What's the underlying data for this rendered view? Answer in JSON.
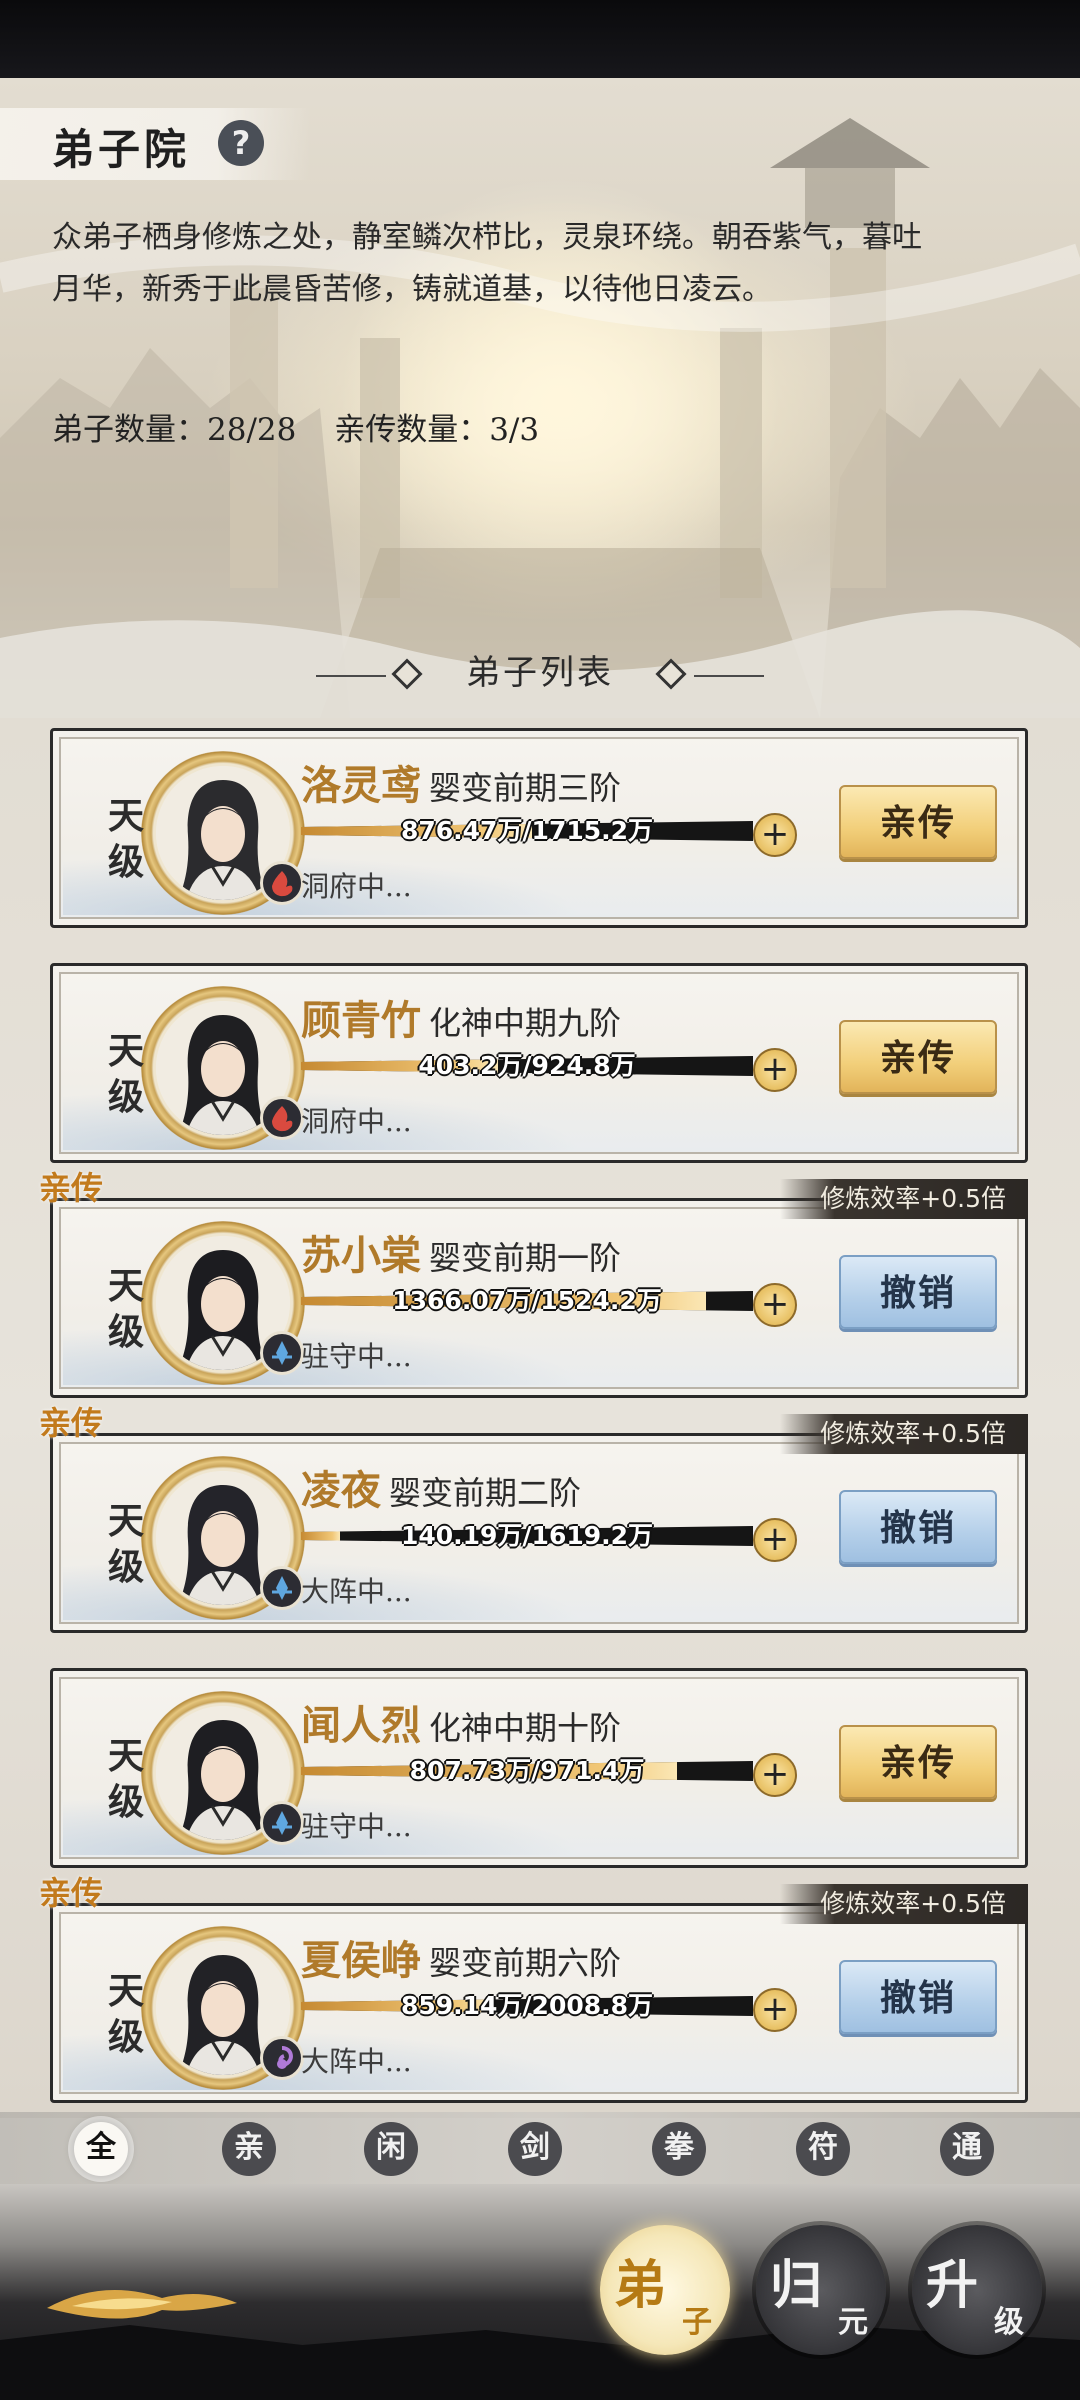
{
  "header": {
    "title": "弟子院",
    "help_icon": "question-icon",
    "help_label": "?",
    "description": "众弟子栖身修炼之处，静室鳞次栉比，灵泉环绕。朝吞紫气，暮吐月华，新秀于此晨昏苦修，铸就道基，以待他日凌云。",
    "disciple_count": "弟子数量：28/28",
    "direct_count": "亲传数量：3/3"
  },
  "list_title": "弟子列表",
  "disciples": [
    {
      "grade_top": "天",
      "grade_bottom": "级",
      "name": "洛灵鸢",
      "realm": "婴变前期三阶",
      "progress_text": "876.47万/1715.2万",
      "progress": 0.511,
      "status": "洞府中...",
      "action": "亲传",
      "action_style": "gold",
      "is_direct": false,
      "bonus": "",
      "element_icon": "fire-icon",
      "element_color": "#d94a3f"
    },
    {
      "grade_top": "天",
      "grade_bottom": "级",
      "name": "顾青竹",
      "realm": "化神中期九阶",
      "progress_text": "403.2万/924.8万",
      "progress": 0.436,
      "status": "洞府中...",
      "action": "亲传",
      "action_style": "gold",
      "is_direct": false,
      "bonus": "",
      "element_icon": "fire-icon",
      "element_color": "#d94a3f"
    },
    {
      "grade_top": "天",
      "grade_bottom": "级",
      "name": "苏小棠",
      "realm": "婴变前期一阶",
      "progress_text": "1366.07万/1524.2万",
      "progress": 0.896,
      "status": "驻守中...",
      "action": "撤销",
      "action_style": "blue",
      "is_direct": true,
      "direct_tag": "亲传",
      "bonus": "修炼效率+0.5倍",
      "element_icon": "water-icon",
      "element_color": "#5fa7e0"
    },
    {
      "grade_top": "天",
      "grade_bottom": "级",
      "name": "凌夜",
      "realm": "婴变前期二阶",
      "progress_text": "140.19万/1619.2万",
      "progress": 0.087,
      "status": "大阵中...",
      "action": "撤销",
      "action_style": "blue",
      "is_direct": true,
      "direct_tag": "亲传",
      "bonus": "修炼效率+0.5倍",
      "element_icon": "water-icon",
      "element_color": "#5fa7e0"
    },
    {
      "grade_top": "天",
      "grade_bottom": "级",
      "name": "闻人烈",
      "realm": "化神中期十阶",
      "progress_text": "807.73万/971.4万",
      "progress": 0.831,
      "status": "驻守中...",
      "action": "亲传",
      "action_style": "gold",
      "is_direct": false,
      "bonus": "",
      "element_icon": "water-icon",
      "element_color": "#5fa7e0"
    },
    {
      "grade_top": "天",
      "grade_bottom": "级",
      "name": "夏侯峥",
      "realm": "婴变前期六阶",
      "progress_text": "859.14万/2008.8万",
      "progress": 0.428,
      "status": "大阵中...",
      "action": "撤销",
      "action_style": "blue",
      "is_direct": true,
      "direct_tag": "亲传",
      "bonus": "修炼效率+0.5倍",
      "element_icon": "wind-icon",
      "element_color": "#b07ad8"
    }
  ],
  "filters": [
    "全",
    "亲",
    "闲",
    "剑",
    "拳",
    "符",
    "通"
  ],
  "active_filter": "全",
  "bottom_nav": [
    {
      "big": "弟",
      "small": "子",
      "selected": true
    },
    {
      "big": "归",
      "small": "元",
      "selected": false
    },
    {
      "big": "升",
      "small": "级",
      "selected": false
    }
  ]
}
